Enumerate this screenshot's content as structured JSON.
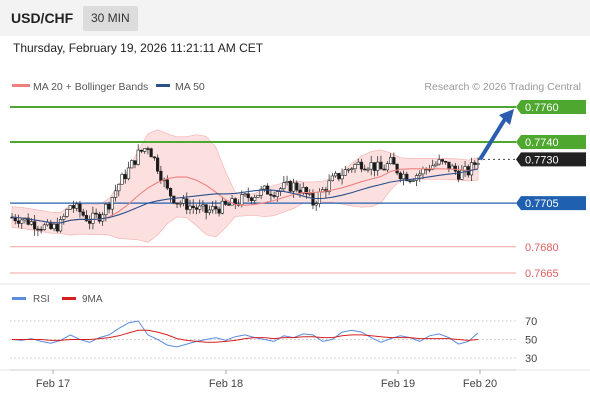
{
  "header": {
    "pair": "USD/CHF",
    "timeframe": "30 MIN"
  },
  "datetime": "Thursday, February 19, 2026 11:21:11 AM CET",
  "colors": {
    "green": "#4ea72e",
    "blue": "#2060b0",
    "red": "#e06060",
    "current": "#222222",
    "ma20": "#f08080",
    "ma50": "#2a4f8a",
    "rsi": "#5a8ce0",
    "ma9": "#d62020"
  },
  "chart_data": [
    {
      "type": "line",
      "title": "",
      "legend": [
        {
          "name": "MA 20 + Bollinger Bands"
        },
        {
          "name": "MA 50"
        }
      ],
      "legend_placement": "top-left",
      "credit": "Research © 2026 Trading Central",
      "x_ticks": [
        "Feb 17",
        "Feb 18",
        "Feb 19",
        "Feb 20"
      ],
      "levels": [
        {
          "label": "0.7760",
          "value": 0.776,
          "kind": "resistance-target"
        },
        {
          "label": "0.7740",
          "value": 0.774,
          "kind": "resistance"
        },
        {
          "label": "0.7730",
          "value": 0.773,
          "kind": "current"
        },
        {
          "label": "0.7705",
          "value": 0.7705,
          "kind": "pivot"
        },
        {
          "label": "0.7680",
          "value": 0.768,
          "kind": "support"
        },
        {
          "label": "0.7665",
          "value": 0.7665,
          "kind": "support"
        }
      ],
      "price_path": [
        0.7697,
        0.7696,
        0.7694,
        0.7692,
        0.769,
        0.7693,
        0.7704,
        0.77,
        0.7695,
        0.7698,
        0.7705,
        0.7716,
        0.7724,
        0.7733,
        0.7738,
        0.7726,
        0.7712,
        0.7706,
        0.7704,
        0.7702,
        0.77,
        0.7702,
        0.7703,
        0.7705,
        0.7708,
        0.771,
        0.7712,
        0.7712,
        0.7714,
        0.7715,
        0.7712,
        0.7705,
        0.7712,
        0.7718,
        0.7722,
        0.7726,
        0.7728,
        0.7727,
        0.7724,
        0.7728,
        0.7722,
        0.772,
        0.7722,
        0.7726,
        0.7728,
        0.7726,
        0.7722,
        0.7723,
        0.773
      ],
      "forecast_target": 0.776
    },
    {
      "type": "line",
      "legend": [
        {
          "name": "RSI"
        },
        {
          "name": "9MA"
        }
      ],
      "ylim": [
        30,
        70
      ],
      "y_ticks": [
        70,
        50,
        30
      ],
      "series": [
        {
          "name": "RSI",
          "values": [
            50,
            49,
            51,
            48,
            46,
            49,
            55,
            50,
            47,
            52,
            55,
            62,
            68,
            70,
            55,
            50,
            44,
            42,
            45,
            48,
            50,
            52,
            49,
            53,
            55,
            52,
            50,
            48,
            54,
            52,
            56,
            55,
            48,
            50,
            58,
            60,
            58,
            52,
            47,
            51,
            54,
            52,
            48,
            54,
            56,
            52,
            45,
            48,
            57
          ]
        },
        {
          "name": "9MA",
          "values": [
            50,
            50,
            50,
            50,
            49,
            49,
            50,
            50,
            50,
            51,
            52,
            54,
            57,
            60,
            60,
            58,
            55,
            51,
            49,
            48,
            47,
            47,
            48,
            49,
            51,
            52,
            52,
            51,
            52,
            52,
            53,
            53,
            52,
            52,
            54,
            55,
            55,
            54,
            53,
            52,
            52,
            52,
            51,
            51,
            51,
            51,
            50,
            49,
            50
          ]
        }
      ]
    }
  ]
}
